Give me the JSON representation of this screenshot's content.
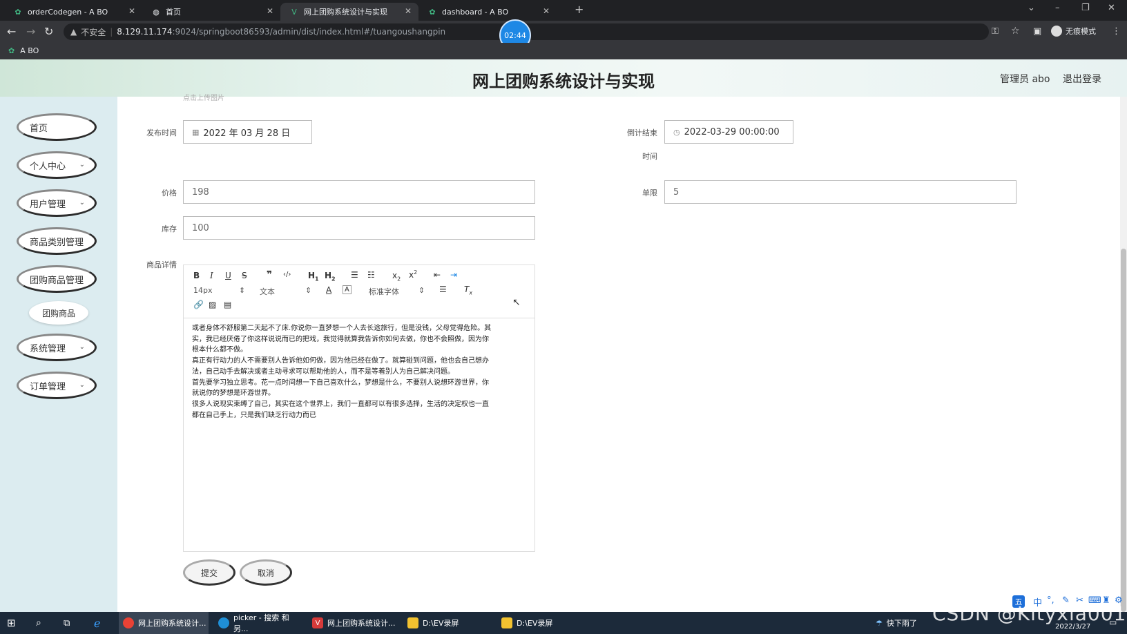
{
  "browser": {
    "tabs": [
      {
        "title": "orderCodegen - A BO"
      },
      {
        "title": "首页"
      },
      {
        "title": "网上团购系统设计与实现"
      },
      {
        "title": "dashboard - A BO"
      }
    ],
    "insecure_label": "不安全",
    "url_host": "8.129.11.174",
    "url_rest": ":9024/springboot86593/admin/dist/index.html#/tuangoushangpin",
    "incognito_label": "无痕模式",
    "bookmark": "A BO",
    "timer": "02:44"
  },
  "header": {
    "title": "网上团购系统设计与实现",
    "admin": "管理员 abo",
    "logout": "退出登录"
  },
  "sidebar": {
    "items": [
      {
        "label": "首页"
      },
      {
        "label": "个人中心"
      },
      {
        "label": "用户管理"
      },
      {
        "label": "商品类别管理"
      },
      {
        "label": "团购商品管理"
      },
      {
        "label": "系统管理"
      },
      {
        "label": "订单管理"
      }
    ],
    "sub_item": "团购商品"
  },
  "form": {
    "upload_hint": "点击上传图片",
    "publish_label": "发布时间",
    "publish_value": "2022 年 03 月 28 日",
    "countdown_label": "倒计结束",
    "countdown_label2": "时间",
    "countdown_value": "2022-03-29 00:00:00",
    "price_label": "价格",
    "price_value": "198",
    "limit_label": "单限",
    "limit_value": "5",
    "stock_label": "库存",
    "stock_value": "100",
    "detail_label": "商品详情",
    "toolbar": {
      "size": "14px",
      "header_select": "文本",
      "font_select": "标准字体"
    },
    "detail_lines": [
      "或者身体不舒服第二天起不了床.你说你一直梦想一个人去长途旅行，但是没钱，父母觉得危险。其",
      "实，我已经厌倦了你这样说说而已的把戏，我觉得就算我告诉你如何去做，你也不会照做，因为你",
      "根本什么都不做。",
      "真正有行动力的人不需要别人告诉他如何做，因为他已经在做了。就算碰到问题，他也会自己想办",
      "法，自己动手去解决或者主动寻求可以帮助他的人，而不是等着别人为自己解决问题。",
      "首先要学习独立思考。花一点时间想一下自己喜欢什么，梦想是什么，不要别人说想环游世界，你",
      "就说你的梦想是环游世界。",
      "很多人说现实束缚了自己，其实在这个世界上，我们一直都可以有很多选择，生活的决定权也一直",
      "都在自己手上，只是我们缺乏行动力而已"
    ],
    "submit": "提交",
    "cancel": "取消"
  },
  "taskbar": {
    "items": [
      {
        "label": "网上团购系统设计..."
      },
      {
        "label": "picker - 搜索 和另..."
      },
      {
        "label": "网上团购系统设计..."
      },
      {
        "label": "D:\\EV录屏"
      },
      {
        "label": "D:\\EV录屏"
      }
    ],
    "weather": "快下雨了",
    "date": "2022/3/27",
    "watermark": "CSDN @Kityxia001"
  },
  "colors": {
    "sidebar_bg": "#dcecf0",
    "taskbar_bg": "#1c2a3a",
    "browser_dark": "#202124",
    "editor_active_icon": "#1e88e5"
  }
}
